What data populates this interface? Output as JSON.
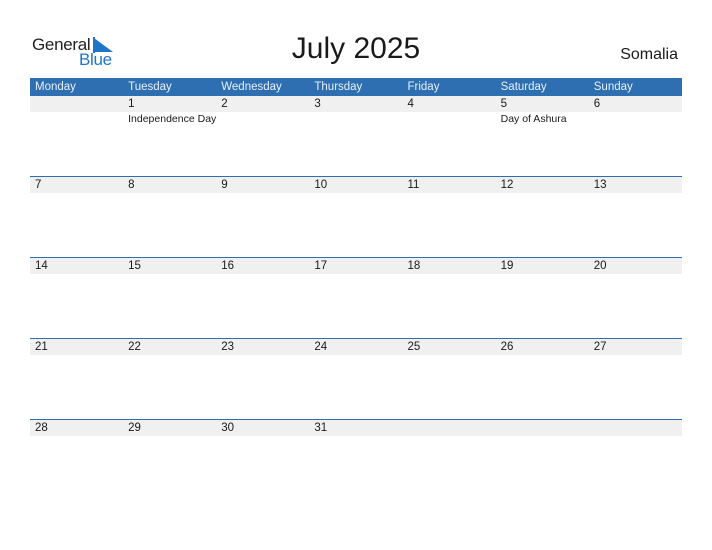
{
  "logo": {
    "line1": "General",
    "line2": "Blue"
  },
  "title": "July 2025",
  "country": "Somalia",
  "colors": {
    "accent": "#2e6fb1",
    "logo_blue": "#1f76c8",
    "date_strip": "#f0f0f0"
  },
  "weekdays": [
    "Monday",
    "Tuesday",
    "Wednesday",
    "Thursday",
    "Friday",
    "Saturday",
    "Sunday"
  ],
  "weeks": [
    {
      "days": [
        "",
        "1",
        "2",
        "3",
        "4",
        "5",
        "6"
      ],
      "events": [
        "",
        "Independence Day",
        "",
        "",
        "",
        "Day of Ashura",
        ""
      ]
    },
    {
      "days": [
        "7",
        "8",
        "9",
        "10",
        "11",
        "12",
        "13"
      ],
      "events": [
        "",
        "",
        "",
        "",
        "",
        "",
        ""
      ]
    },
    {
      "days": [
        "14",
        "15",
        "16",
        "17",
        "18",
        "19",
        "20"
      ],
      "events": [
        "",
        "",
        "",
        "",
        "",
        "",
        ""
      ]
    },
    {
      "days": [
        "21",
        "22",
        "23",
        "24",
        "25",
        "26",
        "27"
      ],
      "events": [
        "",
        "",
        "",
        "",
        "",
        "",
        ""
      ]
    },
    {
      "days": [
        "28",
        "29",
        "30",
        "31",
        "",
        "",
        ""
      ],
      "events": [
        "",
        "",
        "",
        "",
        "",
        "",
        ""
      ]
    }
  ]
}
